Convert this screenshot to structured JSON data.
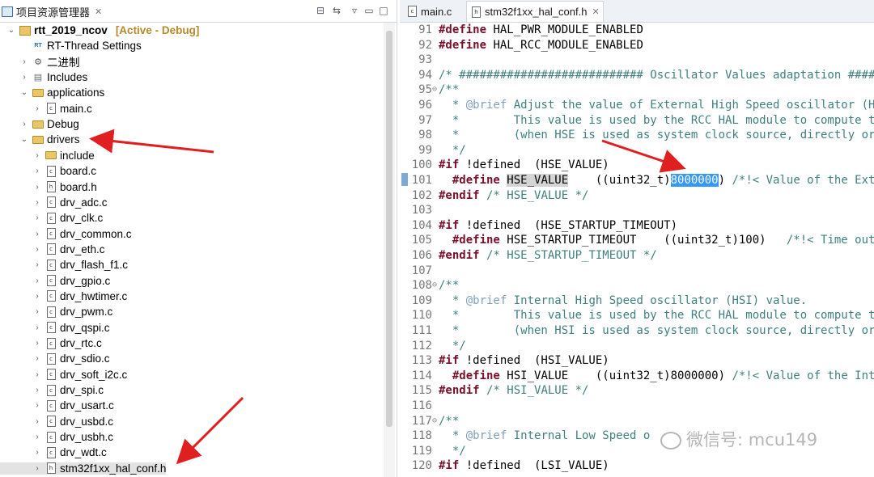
{
  "explorer": {
    "tab_title": "项目资源管理器",
    "tab_close": "✕",
    "toolbar": [
      "collapse-all-icon",
      "link-editor-icon",
      "view-menu-icon",
      "minimize-icon",
      "maximize-icon"
    ],
    "tree": [
      {
        "label": "rtt_2019_ncov",
        "badge": "[Active - Debug]",
        "type": "project",
        "expanded": true,
        "indent": 0
      },
      {
        "label": "RT-Thread Settings",
        "type": "settings",
        "indent": 1
      },
      {
        "label": "二进制",
        "type": "binaries",
        "indent": 1
      },
      {
        "label": "Includes",
        "type": "includes",
        "indent": 1
      },
      {
        "label": "applications",
        "type": "folder",
        "expanded": true,
        "indent": 1
      },
      {
        "label": "main.c",
        "type": "file",
        "indent": 2
      },
      {
        "label": "Debug",
        "type": "folder",
        "indent": 1
      },
      {
        "label": "drivers",
        "type": "folder",
        "expanded": true,
        "indent": 1
      },
      {
        "label": "include",
        "type": "folder",
        "indent": 2
      },
      {
        "label": "board.c",
        "type": "file",
        "indent": 2
      },
      {
        "label": "board.h",
        "type": "file",
        "indent": 2
      },
      {
        "label": "drv_adc.c",
        "type": "file",
        "indent": 2
      },
      {
        "label": "drv_clk.c",
        "type": "file",
        "indent": 2
      },
      {
        "label": "drv_common.c",
        "type": "file",
        "indent": 2
      },
      {
        "label": "drv_eth.c",
        "type": "file",
        "indent": 2
      },
      {
        "label": "drv_flash_f1.c",
        "type": "file",
        "indent": 2
      },
      {
        "label": "drv_gpio.c",
        "type": "file",
        "indent": 2
      },
      {
        "label": "drv_hwtimer.c",
        "type": "file",
        "indent": 2
      },
      {
        "label": "drv_pwm.c",
        "type": "file",
        "indent": 2
      },
      {
        "label": "drv_qspi.c",
        "type": "file",
        "indent": 2
      },
      {
        "label": "drv_rtc.c",
        "type": "file",
        "indent": 2
      },
      {
        "label": "drv_sdio.c",
        "type": "file",
        "indent": 2
      },
      {
        "label": "drv_soft_i2c.c",
        "type": "file",
        "indent": 2
      },
      {
        "label": "drv_spi.c",
        "type": "file",
        "indent": 2
      },
      {
        "label": "drv_usart.c",
        "type": "file",
        "indent": 2
      },
      {
        "label": "drv_usbd.c",
        "type": "file",
        "indent": 2
      },
      {
        "label": "drv_usbh.c",
        "type": "file",
        "indent": 2
      },
      {
        "label": "drv_wdt.c",
        "type": "file",
        "indent": 2
      },
      {
        "label": "stm32f1xx_hal_conf.h",
        "type": "file",
        "indent": 2,
        "selected": true
      }
    ]
  },
  "editor": {
    "tabs": [
      {
        "label": "main.c",
        "active": false
      },
      {
        "label": "stm32f1xx_hal_conf.h",
        "active": true,
        "close": "✕"
      }
    ],
    "lines": [
      {
        "n": "91",
        "segs": [
          [
            "pp",
            "#define "
          ],
          [
            "kw",
            "HAL_PWR_MODULE_ENABLED"
          ]
        ]
      },
      {
        "n": "92",
        "segs": [
          [
            "pp",
            "#define "
          ],
          [
            "kw",
            "HAL_RCC_MODULE_ENABLED"
          ]
        ]
      },
      {
        "n": "93",
        "segs": []
      },
      {
        "n": "94",
        "segs": [
          [
            "cm",
            "/* ########################### Oscillator Values adaptation ####"
          ]
        ]
      },
      {
        "n": "95",
        "fold": "⊖",
        "segs": [
          [
            "cm",
            "/**"
          ]
        ]
      },
      {
        "n": "96",
        "segs": [
          [
            "cm",
            "  * "
          ],
          [
            "cmtag",
            "@brief"
          ],
          [
            "cm",
            " Adjust the value of External High Speed oscillator (H"
          ]
        ]
      },
      {
        "n": "97",
        "segs": [
          [
            "cm",
            "  *        This value is used by the RCC HAL module to compute t"
          ]
        ]
      },
      {
        "n": "98",
        "segs": [
          [
            "cm",
            "  *        (when HSE is used as system clock source, directly or"
          ]
        ]
      },
      {
        "n": "99",
        "segs": [
          [
            "cm",
            "  */"
          ]
        ]
      },
      {
        "n": "100",
        "segs": [
          [
            "pp",
            "#if "
          ],
          [
            "kw",
            "!defined  (HSE_VALUE)"
          ]
        ]
      },
      {
        "n": "101",
        "marker": true,
        "segs": [
          [
            "pp",
            "  #define "
          ],
          [
            "hl-name",
            "HSE_VALUE"
          ],
          [
            "kw",
            "    ((uint32_t)"
          ],
          [
            "hl-sel",
            "8000000"
          ],
          [
            "kw",
            ") "
          ],
          [
            "cm",
            "/*!< Value of the Ext"
          ]
        ]
      },
      {
        "n": "102",
        "segs": [
          [
            "pp",
            "#endif "
          ],
          [
            "cm",
            "/* HSE_VALUE */"
          ]
        ]
      },
      {
        "n": "103",
        "segs": []
      },
      {
        "n": "104",
        "segs": [
          [
            "pp",
            "#if "
          ],
          [
            "kw",
            "!defined  (HSE_STARTUP_TIMEOUT)"
          ]
        ]
      },
      {
        "n": "105",
        "segs": [
          [
            "pp",
            "  #define "
          ],
          [
            "kw",
            "HSE_STARTUP_TIMEOUT    ((uint32_t)100)   "
          ],
          [
            "cm",
            "/*!< Time out"
          ]
        ]
      },
      {
        "n": "106",
        "segs": [
          [
            "pp",
            "#endif "
          ],
          [
            "cm",
            "/* HSE_STARTUP_TIMEOUT */"
          ]
        ]
      },
      {
        "n": "107",
        "segs": []
      },
      {
        "n": "108",
        "fold": "⊖",
        "segs": [
          [
            "cm",
            "/**"
          ]
        ]
      },
      {
        "n": "109",
        "segs": [
          [
            "cm",
            "  * "
          ],
          [
            "cmtag",
            "@brief"
          ],
          [
            "cm",
            " Internal High Speed oscillator (HSI) value."
          ]
        ]
      },
      {
        "n": "110",
        "segs": [
          [
            "cm",
            "  *        This value is used by the RCC HAL module to compute t"
          ]
        ]
      },
      {
        "n": "111",
        "segs": [
          [
            "cm",
            "  *        (when HSI is used as system clock source, directly or"
          ]
        ]
      },
      {
        "n": "112",
        "segs": [
          [
            "cm",
            "  */"
          ]
        ]
      },
      {
        "n": "113",
        "segs": [
          [
            "pp",
            "#if "
          ],
          [
            "kw",
            "!defined  (HSI_VALUE)"
          ]
        ]
      },
      {
        "n": "114",
        "segs": [
          [
            "pp",
            "  #define "
          ],
          [
            "kw",
            "HSI_VALUE    ((uint32_t)8000000) "
          ],
          [
            "cm",
            "/*!< Value of the Int"
          ]
        ]
      },
      {
        "n": "115",
        "segs": [
          [
            "pp",
            "#endif "
          ],
          [
            "cm",
            "/* HSI_VALUE */"
          ]
        ]
      },
      {
        "n": "116",
        "segs": []
      },
      {
        "n": "117",
        "fold": "⊖",
        "segs": [
          [
            "cm",
            "/**"
          ]
        ]
      },
      {
        "n": "118",
        "segs": [
          [
            "cm",
            "  * "
          ],
          [
            "cmtag",
            "@brief"
          ],
          [
            "cm",
            " Internal Low Speed o"
          ]
        ]
      },
      {
        "n": "119",
        "segs": [
          [
            "cm",
            "  */"
          ]
        ]
      },
      {
        "n": "120",
        "segs": [
          [
            "pp",
            "#if "
          ],
          [
            "kw",
            "!defined  (LSI_VALUE)"
          ]
        ]
      }
    ]
  },
  "watermark": "微信号: mcu149",
  "colors": {
    "preprocessor": "#7a0f2a",
    "comment": "#3f7f7f",
    "selection": "#3399ff",
    "arrow": "#e02020",
    "active_debug": "#b58a2a"
  }
}
